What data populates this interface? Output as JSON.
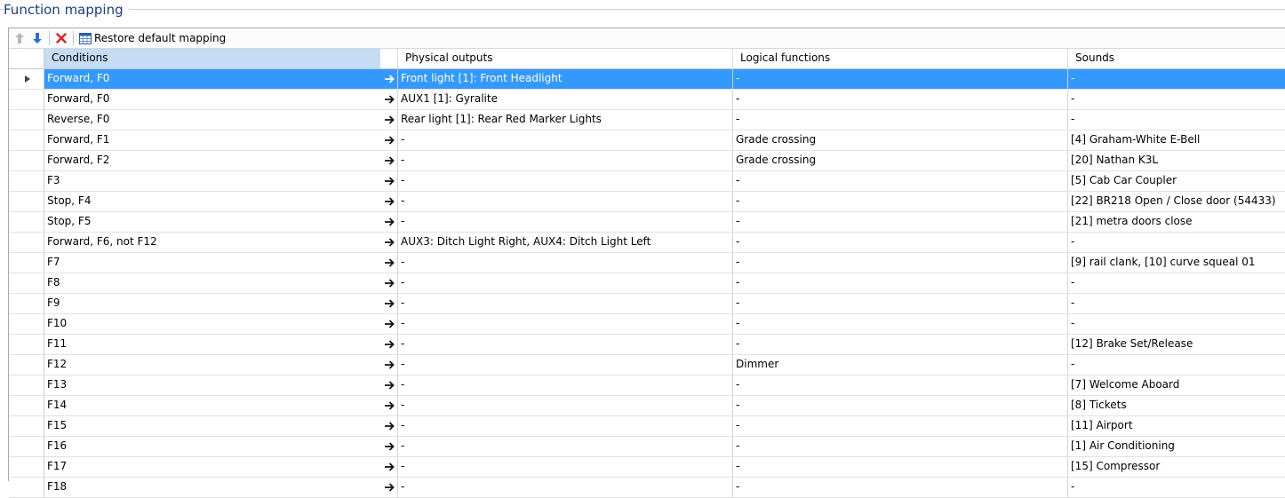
{
  "panel": {
    "title": "Function mapping"
  },
  "toolbar": {
    "restore_label": "Restore default mapping",
    "icons": [
      "arrow-up-icon",
      "arrow-down-icon",
      "delete-icon",
      "table-icon"
    ]
  },
  "colors": {
    "selection": "#3399ff",
    "header_active": "#c4dcf4",
    "delete_red": "#e02020",
    "arrow_down_blue": "#2b6fd6"
  },
  "columns": {
    "conditions": "Conditions",
    "physical": "Physical outputs",
    "logical": "Logical functions",
    "sounds": "Sounds"
  },
  "rows": [
    {
      "cond": "Forward, F0",
      "phys": "Front light [1]: Front Headlight",
      "log": "-",
      "snd": "-"
    },
    {
      "cond": "Forward, F0",
      "phys": "AUX1 [1]: Gyralite",
      "log": "-",
      "snd": "-"
    },
    {
      "cond": "Reverse, F0",
      "phys": "Rear light [1]: Rear Red Marker Lights",
      "log": "-",
      "snd": "-"
    },
    {
      "cond": "Forward, F1",
      "phys": "-",
      "log": "Grade crossing",
      "snd": "[4] Graham-White E-Bell"
    },
    {
      "cond": "Forward, F2",
      "phys": "-",
      "log": "Grade crossing",
      "snd": "[20] Nathan K3L"
    },
    {
      "cond": "F3",
      "phys": "-",
      "log": "-",
      "snd": "[5] Cab Car Coupler"
    },
    {
      "cond": "Stop, F4",
      "phys": "-",
      "log": "-",
      "snd": "[22] BR218 Open / Close door (54433)"
    },
    {
      "cond": "Stop, F5",
      "phys": "-",
      "log": "-",
      "snd": "[21] metra doors close"
    },
    {
      "cond": "Forward, F6, not F12",
      "phys": "AUX3: Ditch Light Right, AUX4: Ditch Light Left",
      "log": "-",
      "snd": "-"
    },
    {
      "cond": "F7",
      "phys": "-",
      "log": "-",
      "snd": "[9] rail clank, [10] curve squeal 01"
    },
    {
      "cond": "F8",
      "phys": "-",
      "log": "-",
      "snd": "-"
    },
    {
      "cond": "F9",
      "phys": "-",
      "log": "-",
      "snd": "-"
    },
    {
      "cond": "F10",
      "phys": "-",
      "log": "-",
      "snd": "-"
    },
    {
      "cond": "F11",
      "phys": "-",
      "log": "-",
      "snd": "[12] Brake Set/Release"
    },
    {
      "cond": "F12",
      "phys": "-",
      "log": "Dimmer",
      "snd": "-"
    },
    {
      "cond": "F13",
      "phys": "-",
      "log": "-",
      "snd": "[7] Welcome Aboard"
    },
    {
      "cond": "F14",
      "phys": "-",
      "log": "-",
      "snd": "[8] Tickets"
    },
    {
      "cond": "F15",
      "phys": "-",
      "log": "-",
      "snd": "[11] Airport"
    },
    {
      "cond": "F16",
      "phys": "-",
      "log": "-",
      "snd": "[1] Air Conditioning"
    },
    {
      "cond": "F17",
      "phys": "-",
      "log": "-",
      "snd": "[15] Compressor"
    },
    {
      "cond": "F18",
      "phys": "-",
      "log": "-",
      "snd": "-"
    }
  ],
  "selected_row": 0
}
